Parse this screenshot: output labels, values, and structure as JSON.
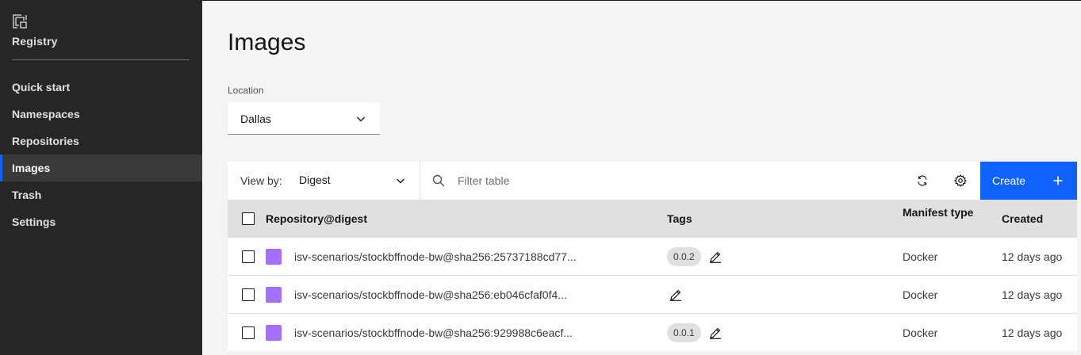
{
  "sidebar": {
    "brand_icon": "registry-icon",
    "brand_label": "Registry",
    "items": [
      {
        "label": "Quick start"
      },
      {
        "label": "Namespaces"
      },
      {
        "label": "Repositories"
      },
      {
        "label": "Images",
        "active": true
      },
      {
        "label": "Trash"
      },
      {
        "label": "Settings"
      }
    ]
  },
  "page": {
    "title": "Images",
    "location_label": "Location",
    "location_value": "Dallas"
  },
  "toolbar": {
    "view_by_label": "View by:",
    "view_by_value": "Digest",
    "search_placeholder": "Filter table",
    "create_label": "Create"
  },
  "table": {
    "headers": {
      "repository": "Repository@digest",
      "tags": "Tags",
      "manifest": "Manifest type",
      "created": "Created"
    },
    "rows": [
      {
        "repository": "isv-scenarios/stockbffnode-bw@sha256:25737188cd77...",
        "tag": "0.0.2",
        "manifest": "Docker",
        "created": "12 days ago"
      },
      {
        "repository": "isv-scenarios/stockbffnode-bw@sha256:eb046cfaf0f4...",
        "tag": "",
        "manifest": "Docker",
        "created": "12 days ago"
      },
      {
        "repository": "isv-scenarios/stockbffnode-bw@sha256:929988c6eacf...",
        "tag": "0.0.1",
        "manifest": "Docker",
        "created": "12 days ago"
      }
    ]
  },
  "colors": {
    "accent": "#0f62fe",
    "sidebar_bg": "#262626",
    "repo_swatch": "#a56eff"
  }
}
